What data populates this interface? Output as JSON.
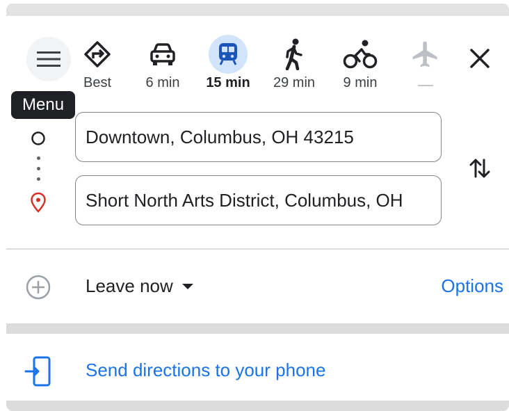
{
  "tooltip": {
    "menu": "Menu"
  },
  "travel_modes": [
    {
      "label": "Best",
      "icon": "best-route-icon"
    },
    {
      "label": "6 min",
      "icon": "car-icon"
    },
    {
      "label": "15 min",
      "icon": "transit-icon",
      "selected": true
    },
    {
      "label": "29 min",
      "icon": "walking-icon"
    },
    {
      "label": "9 min",
      "icon": "bicycle-icon"
    },
    {
      "label": "—",
      "icon": "flight-icon",
      "disabled": true
    }
  ],
  "origin": {
    "value": "Downtown, Columbus, OH 43215"
  },
  "destination": {
    "value": "Short North Arts District, Columbus, OH"
  },
  "departure": {
    "label": "Leave now"
  },
  "options_label": "Options",
  "send_directions_label": "Send directions to your phone",
  "colors": {
    "accent_blue": "#1a73e8",
    "transit_highlight": "#d2e3fc",
    "destination_red": "#d93025",
    "tooltip_bg": "#202124"
  }
}
